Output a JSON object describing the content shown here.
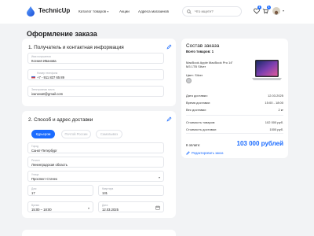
{
  "header": {
    "logo_text": "TechnicUp",
    "nav": [
      {
        "label": "Каталог товаров",
        "has_caret": true
      },
      {
        "label": "Акции",
        "has_caret": false
      },
      {
        "label": "Адреса магазинов",
        "has_caret": false
      }
    ],
    "search_placeholder": "Что ищете?",
    "favorites_count": "1",
    "cart_count": "1"
  },
  "page": {
    "title": "Оформление заказа"
  },
  "contact": {
    "title": "1. Получатель и контактная информация",
    "name_label": "Имя получателя",
    "name_value": "Ксения Иванова",
    "phone_label": "Номер телефона",
    "phone_value": "+7 - 911 837 65 89",
    "email_label": "Электронная почта",
    "email_value": "ivanova8@gmail.com"
  },
  "delivery": {
    "title": "2. Способ и адрес доставки",
    "methods": [
      "Курьером",
      "Почтой России",
      "Самовывоз"
    ],
    "active_method": "Курьером",
    "city_label": "Город",
    "city_value": "Санкт-Петербург",
    "region_label": "Регион",
    "region_value": "Ленинградская область",
    "street_label": "Улица",
    "street_value": "Проспект Стачек",
    "house_label": "Дом",
    "house_value": "17",
    "apartment_label": "Квартира",
    "apartment_value": "131",
    "time_label": "Время",
    "time_value": "15:00 – 18:00",
    "date_label": "Дата",
    "date_value": "12.03.2025"
  },
  "summary": {
    "title": "Состав заказа",
    "total_items": "Всего товаров: 1",
    "product_name": "MacBook Apple MacBook Pro 14\" M3 1TB Silver",
    "product_color": "Цвет: Silver",
    "rows": [
      {
        "label": "Дата доставки:",
        "value": "12.03.2025"
      },
      {
        "label": "Время доставки:",
        "value": "15:00 - 18:00"
      },
      {
        "label": "Вес доставки:",
        "value": "2 кг"
      }
    ],
    "price_rows": [
      {
        "label": "Стоимость товаров:",
        "value": "102 000 руб."
      },
      {
        "label": "Стоимость доставки:",
        "value": "1000 руб."
      }
    ],
    "pay_label": "К оплате:",
    "pay_total": "103 000 рублей",
    "edit_label": "Редактировать заказ"
  },
  "colors": {
    "accent": "#1a6bff",
    "background": "#f2f3f5",
    "card": "#ffffff"
  }
}
